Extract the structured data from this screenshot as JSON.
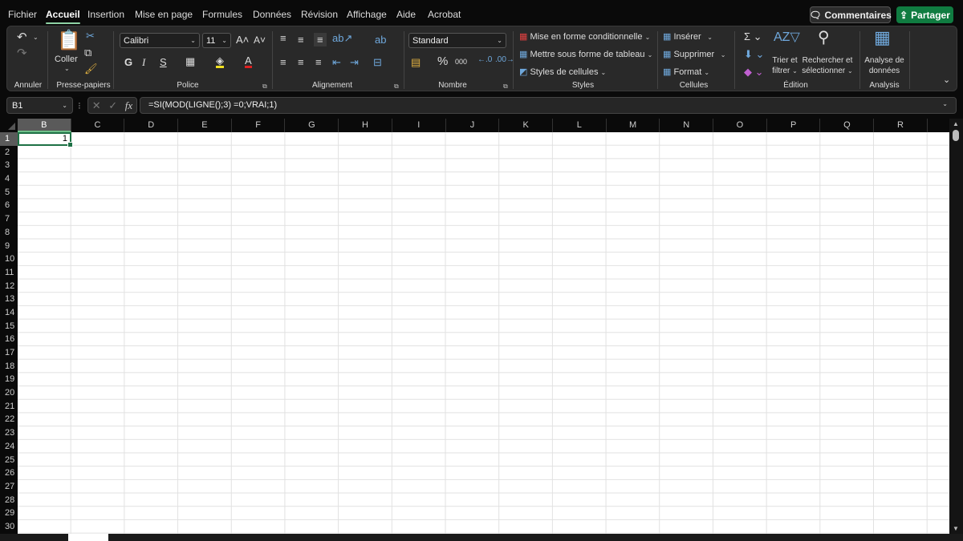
{
  "tabs": [
    "Fichier",
    "Accueil",
    "Insertion",
    "Mise en page",
    "Formules",
    "Données",
    "Révision",
    "Affichage",
    "Aide",
    "Acrobat"
  ],
  "active_tab": "Accueil",
  "header_buttons": {
    "comments": "Commentaires",
    "share": "Partager"
  },
  "colors": {
    "accent": "#107c41",
    "selection": "#1e7145",
    "tab_underline": "#8fd3a5"
  },
  "ribbon": {
    "undo_group": {
      "label": "Annuler"
    },
    "clipboard": {
      "label": "Presse-papiers",
      "paste": "Coller"
    },
    "font": {
      "label": "Police",
      "name": "Calibri",
      "size": "11",
      "bold": "G",
      "italic": "I",
      "underline": "S",
      "color_letter": "A"
    },
    "alignment": {
      "label": "Alignement"
    },
    "number": {
      "label": "Nombre",
      "format": "Standard",
      "percent": "%",
      "thousands": "000"
    },
    "styles": {
      "label": "Styles",
      "items": [
        "Mise en forme conditionnelle",
        "Mettre sous forme de tableau",
        "Styles de cellules"
      ]
    },
    "cells": {
      "label": "Cellules",
      "items": [
        "Insérer",
        "Supprimer",
        "Format"
      ]
    },
    "editing": {
      "label": "Édition",
      "sort_filter": [
        "Trier et",
        "filtrer"
      ],
      "find_select": [
        "Rechercher et",
        "sélectionner"
      ]
    },
    "analysis": {
      "label": "Analysis",
      "button": [
        "Analyse de",
        "données"
      ]
    }
  },
  "formula_bar": {
    "name_box": "B1",
    "fx": "fx",
    "formula": "=SI(MOD(LIGNE();3) =0;VRAI;1)"
  },
  "columns": [
    "B",
    "C",
    "D",
    "E",
    "F",
    "G",
    "H",
    "I",
    "J",
    "K",
    "L",
    "M",
    "N",
    "O",
    "P",
    "Q",
    "R"
  ],
  "rows": [
    "1",
    "2",
    "3",
    "4",
    "5",
    "6",
    "7",
    "8",
    "9",
    "10",
    "11",
    "12",
    "13",
    "14",
    "15",
    "16",
    "17",
    "18",
    "19",
    "20",
    "21",
    "22",
    "23",
    "24",
    "25",
    "26",
    "27",
    "28",
    "29",
    "30"
  ],
  "selected_cell": {
    "ref": "B1",
    "value": "1"
  }
}
